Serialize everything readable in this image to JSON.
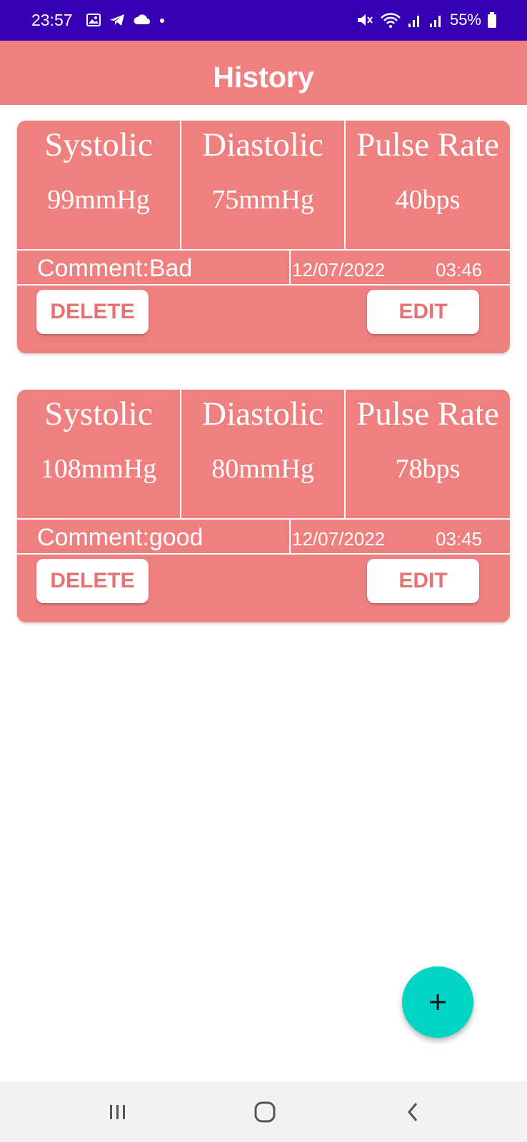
{
  "status_bar": {
    "time": "23:57",
    "battery": "55%",
    "icons": [
      "image-icon",
      "telegram-icon",
      "cloud-icon",
      "dot-icon",
      "mute-icon",
      "wifi-icon",
      "signal-icon",
      "signal-icon",
      "battery-icon"
    ],
    "background": "#3700b3"
  },
  "app_bar": {
    "title": "History",
    "background": "#f08080"
  },
  "records": [
    {
      "systolic_label": "Systolic",
      "diastolic_label": "Diastolic",
      "pulse_label": "Pulse Rate",
      "systolic": "99mmHg",
      "diastolic": "75mmHg",
      "pulse": "40bps",
      "comment": "Comment:Bad",
      "date": "12/07/2022",
      "time": "03:46",
      "delete_label": "DELETE",
      "edit_label": "EDIT"
    },
    {
      "systolic_label": "Systolic",
      "diastolic_label": "Diastolic",
      "pulse_label": "Pulse Rate",
      "systolic": "108mmHg",
      "diastolic": "80mmHg",
      "pulse": "78bps",
      "comment": "Comment:good",
      "date": "12/07/2022",
      "time": "03:45",
      "delete_label": "DELETE",
      "edit_label": "EDIT"
    }
  ],
  "fab": {
    "icon": "plus-icon",
    "color": "#00d5c4"
  },
  "nav_bar": {
    "icons": [
      "recent-apps-icon",
      "home-icon",
      "back-icon"
    ]
  }
}
